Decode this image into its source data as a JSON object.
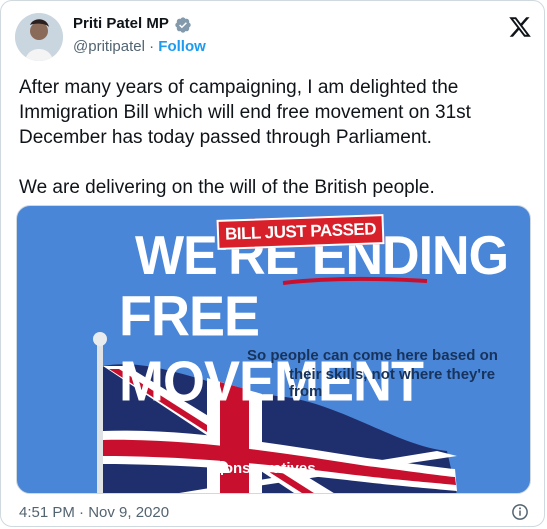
{
  "author": {
    "name": "Priti Patel MP",
    "handle": "@pritipatel",
    "separator": "·",
    "follow_label": "Follow"
  },
  "icons": {
    "verified": "verified-badge-icon",
    "platform": "x-logo-icon",
    "info": "info-icon"
  },
  "tweet": {
    "text": "After many years of campaigning, I am delighted the Immigration Bill which will end free movement on 31st December has today passed through Parliament.\n\nWe are delivering on the will of the British people."
  },
  "media": {
    "badge": "BILL JUST PASSED",
    "headline_line1": "WE'RE ENDING",
    "headline_line2": "FREE MOVEMENT",
    "subtitle_line1": "So people can come here based on",
    "subtitle_line2": "their skills, not where they're from",
    "brand": "Conservatives"
  },
  "timestamp": "4:51 PM · Nov 9, 2020",
  "colors": {
    "accent": "#1d9bf0",
    "media_background": "#4a86d8",
    "badge": "#d8202a"
  }
}
